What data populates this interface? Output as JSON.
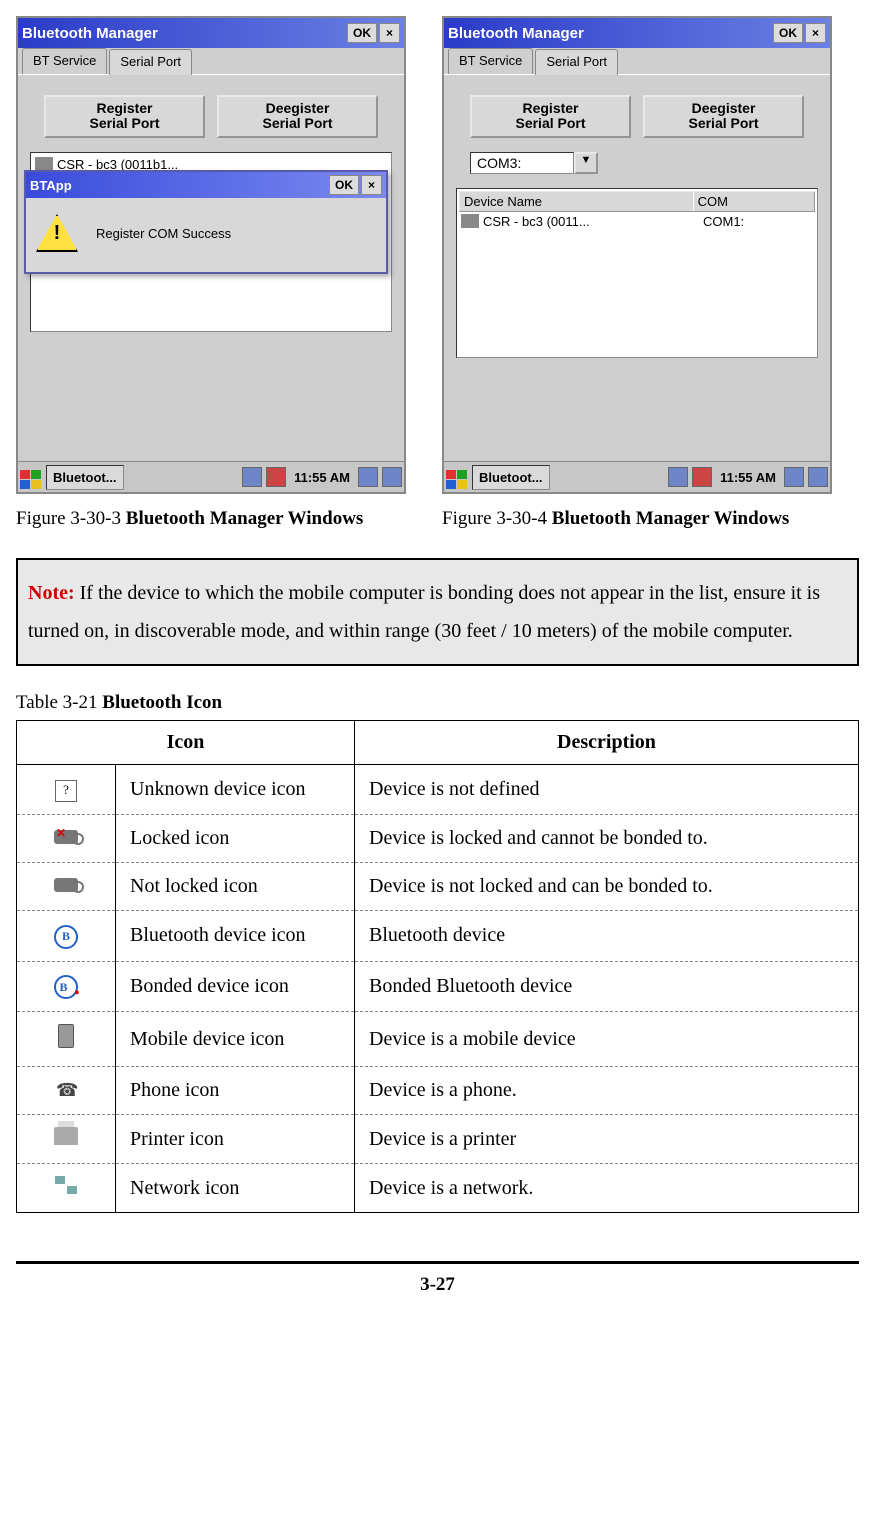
{
  "screenshots": {
    "left": {
      "title": "Bluetooth Manager",
      "ok": "OK",
      "tabs": [
        "BT Service",
        "Serial Port"
      ],
      "active_tab": 1,
      "buttons": {
        "register": "Register\nSerial Port",
        "deregister": "Deegister\nSerial Port"
      },
      "list_item": "CSR - bc3 (0011b1...",
      "dialog": {
        "title": "BTApp",
        "ok": "OK",
        "message": "Register COM Success"
      },
      "taskbar": {
        "app": "Bluetoot...",
        "time": "11:55 AM"
      }
    },
    "right": {
      "title": "Bluetooth Manager",
      "ok": "OK",
      "tabs": [
        "BT Service",
        "Serial Port"
      ],
      "active_tab": 1,
      "buttons": {
        "register": "Register\nSerial Port",
        "deregister": "Deegister\nSerial Port"
      },
      "combo": "COM3:",
      "list_header": {
        "col1": "Device Name",
        "col2": "COM"
      },
      "list_row": {
        "name": "CSR - bc3 (0011...",
        "com": "COM1:"
      },
      "taskbar": {
        "app": "Bluetoot...",
        "time": "11:55 AM"
      }
    }
  },
  "captions": {
    "left_prefix": "Figure 3-30-3 ",
    "left_bold": "Bluetooth Manager Windows",
    "right_prefix": "Figure 3-30-4 ",
    "right_bold": "Bluetooth Manager Windows"
  },
  "note": {
    "label": "Note:",
    "text": " If the device to which the mobile computer is bonding does not appear in the list, ensure it is turned on, in discoverable mode, and within range (30 feet / 10 meters) of the mobile computer."
  },
  "table_caption": {
    "prefix": "Table 3-21 ",
    "bold": "Bluetooth Icon"
  },
  "table": {
    "headers": {
      "icon": "Icon",
      "desc": "Description"
    },
    "rows": [
      {
        "icon_name": "unknown-icon",
        "name": "Unknown device icon",
        "desc": "Device is not defined"
      },
      {
        "icon_name": "locked-icon",
        "name": "Locked icon",
        "desc": "Device is locked and cannot be bonded to."
      },
      {
        "icon_name": "not-locked-icon",
        "name": "Not locked icon",
        "desc": "Device is not locked and can be bonded to."
      },
      {
        "icon_name": "bluetooth-device-icon",
        "name": "Bluetooth device icon",
        "desc": "Bluetooth device"
      },
      {
        "icon_name": "bonded-device-icon",
        "name": "Bonded device icon",
        "desc": "Bonded Bluetooth device"
      },
      {
        "icon_name": "mobile-device-icon",
        "name": "Mobile device icon",
        "desc": "Device is a mobile device"
      },
      {
        "icon_name": "phone-icon",
        "name": "Phone icon",
        "desc": "Device is a phone."
      },
      {
        "icon_name": "printer-icon",
        "name": "Printer icon",
        "desc": "Device is a printer"
      },
      {
        "icon_name": "network-icon",
        "name": "Network icon",
        "desc": "Device is a network."
      }
    ]
  },
  "page_number": "3-27"
}
